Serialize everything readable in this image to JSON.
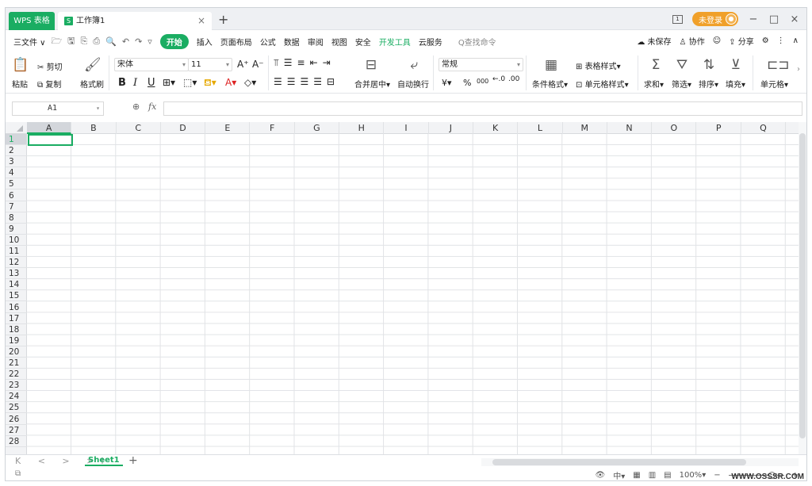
{
  "titlebar": {
    "app_tab": "WPS 表格",
    "doc_tab": "工作簿1",
    "doc_icon": "S",
    "close": "×",
    "new_tab": "+",
    "login": "未登录",
    "minimize": "−",
    "restore": "□",
    "close_window": "×"
  },
  "menubar": {
    "file": "三文件 ∨",
    "start": "开始",
    "tabs": [
      "插入",
      "页面布局",
      "公式",
      "数据",
      "审阅",
      "视图",
      "安全"
    ],
    "dev": "开发工具",
    "cloud": "云服务",
    "search": "Q查找命令",
    "unsaved": "未保存",
    "collab": "协作",
    "share": "分享"
  },
  "ribbon": {
    "paste": "粘贴",
    "cut": "剪切",
    "copy": "复制",
    "format_painter": "格式刷",
    "font_name": "宋体",
    "font_size": "11",
    "bold": "B",
    "italic": "I",
    "underline": "U",
    "font_grow": "A⁺",
    "font_shrink": "A⁻",
    "merge_center": "合并居中",
    "wrap_text": "自动换行",
    "number_format": "常规",
    "currency": "¥",
    "percent": "%",
    "thousands": "000",
    "cond_format": "条件格式",
    "table_style": "表格样式",
    "cell_style": "单元格样式",
    "sum": "求和",
    "filter": "筛选",
    "sort": "排序",
    "fill": "填充",
    "cells": "单元格"
  },
  "formula_bar": {
    "name_box": "A1",
    "fx": "fx"
  },
  "grid": {
    "columns": [
      "A",
      "B",
      "C",
      "D",
      "E",
      "F",
      "G",
      "H",
      "I",
      "J",
      "K",
      "L",
      "M",
      "N",
      "O",
      "P",
      "Q"
    ],
    "rows": [
      "1",
      "2",
      "3",
      "4",
      "5",
      "6",
      "7",
      "8",
      "9",
      "10",
      "11",
      "12",
      "13",
      "14",
      "15",
      "16",
      "17",
      "18",
      "19",
      "20",
      "21",
      "22",
      "23",
      "24",
      "25",
      "26",
      "27",
      "28"
    ],
    "active_cell": "A1"
  },
  "sheetbar": {
    "nav": "K < > >I",
    "sheet": "Sheet1",
    "add": "+"
  },
  "statusbar": {
    "zoom": "100%",
    "zoom_minus": "−",
    "zoom_plus": "+"
  },
  "watermark": "WWW.OSSSR.COM",
  "colors": {
    "accent": "#1aad62",
    "login": "#f0a02a"
  }
}
